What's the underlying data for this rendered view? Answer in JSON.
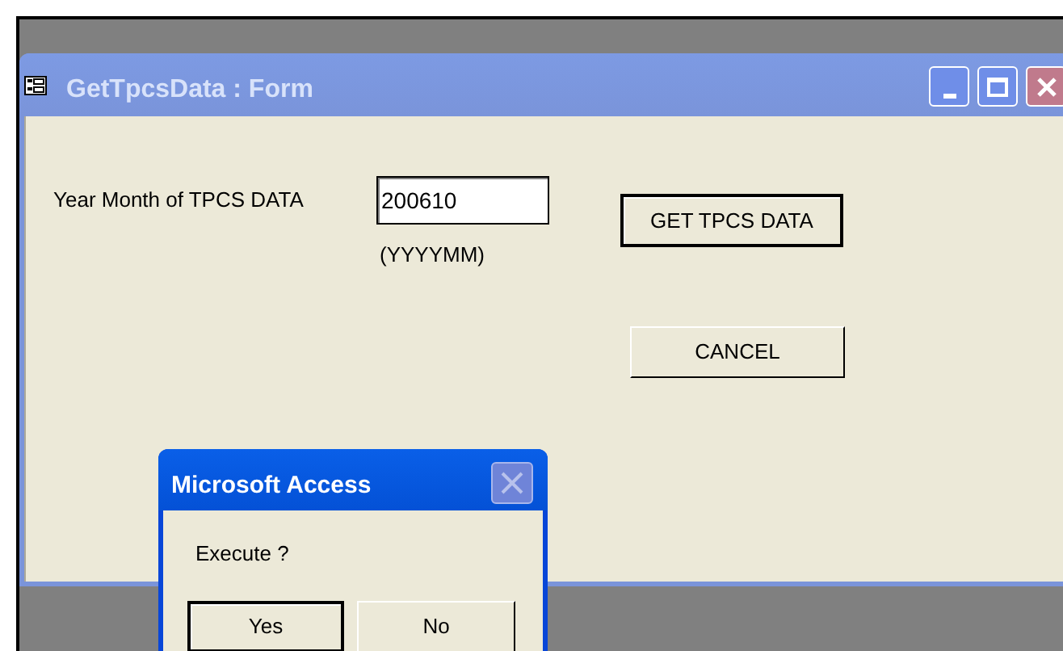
{
  "form": {
    "title": "GetTpcsData : Form",
    "active": false,
    "field": {
      "label": "Year Month of TPCS DATA",
      "value": "200610",
      "hint": "(YYYYMM)"
    },
    "buttons": [
      {
        "label": "GET TPCS DATA",
        "default": true
      },
      {
        "label": "CANCEL",
        "default": false
      }
    ]
  },
  "dialog": {
    "title": "Microsoft Access",
    "active": true,
    "close_disabled": true,
    "message": "Execute ?",
    "buttons": [
      {
        "label": "Yes",
        "default": true
      },
      {
        "label": "No",
        "default": false
      }
    ]
  }
}
